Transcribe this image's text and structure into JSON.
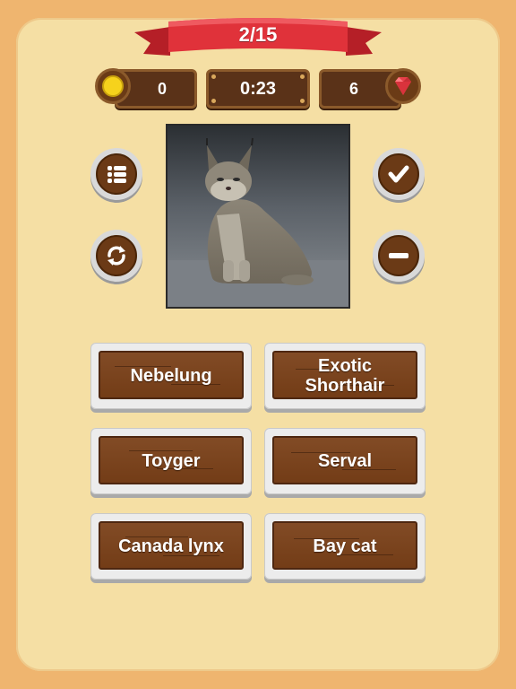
{
  "header": {
    "progress": "2/15",
    "coins": "0",
    "timer": "0:23",
    "gems": "6"
  },
  "icons": {
    "coin": "coin-icon",
    "gem": "gem-icon",
    "list": "list-icon",
    "refresh": "refresh-icon",
    "check": "check-icon",
    "minus": "minus-icon"
  },
  "question": {
    "image_subject": "lynx photo"
  },
  "answers": [
    {
      "label": "Nebelung"
    },
    {
      "label": "Exotic Shorthair"
    },
    {
      "label": "Toyger"
    },
    {
      "label": "Serval"
    },
    {
      "label": "Canada lynx"
    },
    {
      "label": "Bay cat"
    }
  ],
  "colors": {
    "background": "#efb56f",
    "panel": "#f5dfa4",
    "ribbon": "#e0323a",
    "wood": "#7a4018",
    "gem": "#e8404a"
  }
}
